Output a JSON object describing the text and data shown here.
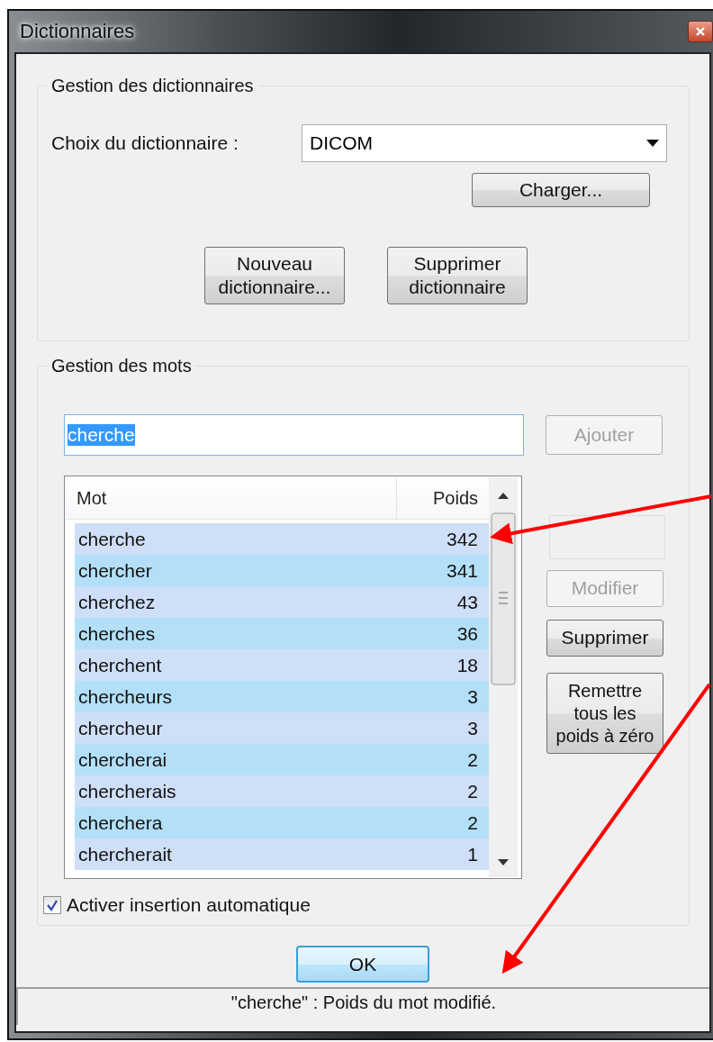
{
  "window": {
    "title": "Dictionnaires"
  },
  "dictionaries_group": {
    "legend": "Gestion des dictionnaires",
    "choice_label": "Choix du dictionnaire :",
    "choice_value": "DICOM",
    "load_button": {
      "label": "Charger...",
      "disabled": false
    },
    "buttons": [
      {
        "label": "Nouveau dictionnaire...",
        "disabled": false
      },
      {
        "label": "Supprimer dictionnaire",
        "disabled": false
      }
    ]
  },
  "words_group": {
    "legend": "Gestion des mots",
    "input": {
      "value": "cherche",
      "text_selected": true
    },
    "add_button": {
      "label": "Ajouter",
      "disabled": true
    },
    "table": {
      "columns": [
        "Mot",
        "Poids"
      ],
      "rows": [
        {
          "word": "cherche",
          "weight": "342"
        },
        {
          "word": "chercher",
          "weight": "341"
        },
        {
          "word": "cherchez",
          "weight": "43"
        },
        {
          "word": "cherches",
          "weight": "36"
        },
        {
          "word": "cherchent",
          "weight": "18"
        },
        {
          "word": "chercheurs",
          "weight": "3"
        },
        {
          "word": "chercheur",
          "weight": "3"
        },
        {
          "word": "chercherai",
          "weight": "2"
        },
        {
          "word": "chercherais",
          "weight": "2"
        },
        {
          "word": "cherchera",
          "weight": "2"
        },
        {
          "word": "chercherait",
          "weight": "1"
        }
      ]
    },
    "weight_field": {
      "disabled": true
    },
    "side_buttons": [
      {
        "label": "Modifier",
        "disabled": true
      },
      {
        "label": "Supprimer",
        "disabled": false
      },
      {
        "label": "Remettre tous les poids à zéro",
        "disabled": false
      }
    ],
    "checkbox": {
      "label": "Activer insertion automatique",
      "checked": true
    }
  },
  "ok_button": {
    "label": "OK"
  },
  "status_bar": {
    "text": "\"cherche\" : Poids du mot modifié."
  }
}
